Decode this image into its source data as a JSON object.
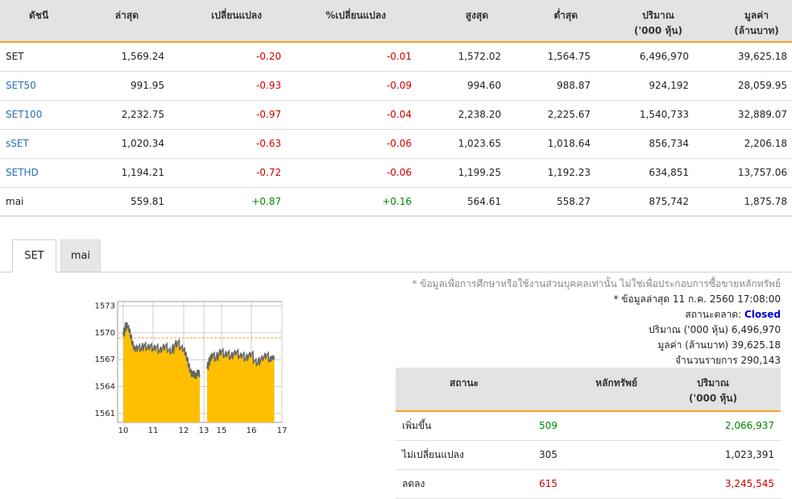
{
  "index_table": {
    "headers": {
      "name": "ดัชนี",
      "last": "ล่าสุด",
      "change": "เปลี่ยนแปลง",
      "pct_change": "%เปลี่ยนแปลง",
      "high": "สูงสุด",
      "low": "ต่ำสุด",
      "volume_l1": "ปริมาณ",
      "volume_l2": "('000 หุ้น)",
      "value_l1": "มูลค่า",
      "value_l2": "(ล้านบาท)"
    },
    "rows": [
      {
        "name": "SET",
        "last": "1,569.24",
        "change": "-0.20",
        "pct": "-0.01",
        "high": "1,572.02",
        "low": "1,564.75",
        "volume": "6,496,970",
        "value": "39,625.18"
      },
      {
        "name": "SET50",
        "last": "991.95",
        "change": "-0.93",
        "pct": "-0.09",
        "high": "994.60",
        "low": "988.87",
        "volume": "924,192",
        "value": "28,059.95"
      },
      {
        "name": "SET100",
        "last": "2,232.75",
        "change": "-0.97",
        "pct": "-0.04",
        "high": "2,238.20",
        "low": "2,225.67",
        "volume": "1,540,733",
        "value": "32,889.07"
      },
      {
        "name": "sSET",
        "last": "1,020.34",
        "change": "-0.63",
        "pct": "-0.06",
        "high": "1,023.65",
        "low": "1,018.64",
        "volume": "856,734",
        "value": "2,206.18"
      },
      {
        "name": "SETHD",
        "last": "1,194.21",
        "change": "-0.72",
        "pct": "-0.06",
        "high": "1,199.25",
        "low": "1,192.23",
        "volume": "634,851",
        "value": "13,757.06"
      },
      {
        "name": "mai",
        "last": "559.81",
        "change": "+0.87",
        "pct": "+0.16",
        "high": "564.61",
        "low": "558.27",
        "volume": "875,742",
        "value": "1,875.78"
      }
    ]
  },
  "tabs": [
    {
      "label": "SET"
    },
    {
      "label": "mai"
    }
  ],
  "chart_data": {
    "type": "area",
    "x_ticks": [
      "10",
      "11",
      "12",
      "13",
      "15",
      "16",
      "17"
    ],
    "y_ticks": [
      "1573",
      "1570",
      "1567",
      "1564",
      "1561"
    ],
    "ylim": [
      1560,
      1573.5
    ],
    "prev_close": 1569.44,
    "colors": {
      "fill": "#ffbf00",
      "line": "#666666",
      "prev_close": "#f4a326",
      "grid": "#cccccc"
    },
    "morning": {
      "x_range": [
        10.0,
        12.5
      ],
      "points": [
        [
          10.0,
          1569.7
        ],
        [
          10.05,
          1570.3
        ],
        [
          10.1,
          1570.9
        ],
        [
          10.15,
          1570.6
        ],
        [
          10.2,
          1570.2
        ],
        [
          10.25,
          1569.5
        ],
        [
          10.3,
          1568.8
        ],
        [
          10.35,
          1568.3
        ],
        [
          10.4,
          1568.0
        ],
        [
          10.5,
          1568.4
        ],
        [
          10.6,
          1568.1
        ],
        [
          10.7,
          1568.6
        ],
        [
          10.8,
          1568.2
        ],
        [
          10.9,
          1568.5
        ],
        [
          11.0,
          1568.1
        ],
        [
          11.1,
          1568.4
        ],
        [
          11.2,
          1567.9
        ],
        [
          11.3,
          1568.2
        ],
        [
          11.4,
          1568.5
        ],
        [
          11.5,
          1568.0
        ],
        [
          11.6,
          1567.8
        ],
        [
          11.7,
          1568.5
        ],
        [
          11.8,
          1568.9
        ],
        [
          11.9,
          1568.3
        ],
        [
          12.0,
          1568.1
        ],
        [
          12.05,
          1567.6
        ],
        [
          12.1,
          1567.0
        ],
        [
          12.15,
          1566.3
        ],
        [
          12.2,
          1565.7
        ],
        [
          12.25,
          1565.2
        ],
        [
          12.3,
          1565.5
        ],
        [
          12.35,
          1565.0
        ],
        [
          12.4,
          1565.3
        ],
        [
          12.45,
          1565.6
        ],
        [
          12.5,
          1565.2
        ]
      ]
    },
    "afternoon": {
      "x_range": [
        14.5,
        16.75
      ],
      "points": [
        [
          14.5,
          1566.0
        ],
        [
          14.55,
          1566.5
        ],
        [
          14.6,
          1567.0
        ],
        [
          14.65,
          1567.3
        ],
        [
          14.7,
          1567.5
        ],
        [
          14.8,
          1567.0
        ],
        [
          14.9,
          1567.6
        ],
        [
          15.0,
          1567.9
        ],
        [
          15.1,
          1567.4
        ],
        [
          15.2,
          1567.7
        ],
        [
          15.3,
          1567.2
        ],
        [
          15.4,
          1567.6
        ],
        [
          15.5,
          1567.8
        ],
        [
          15.6,
          1567.3
        ],
        [
          15.7,
          1567.5
        ],
        [
          15.8,
          1567.0
        ],
        [
          15.9,
          1567.4
        ],
        [
          16.0,
          1567.6
        ],
        [
          16.1,
          1566.8
        ],
        [
          16.2,
          1566.5
        ],
        [
          16.3,
          1567.0
        ],
        [
          16.4,
          1567.2
        ],
        [
          16.5,
          1567.5
        ],
        [
          16.6,
          1566.9
        ],
        [
          16.65,
          1567.1
        ],
        [
          16.7,
          1567.2
        ],
        [
          16.75,
          1567.2
        ]
      ]
    }
  },
  "info": {
    "disclaimer": "* ข้อมูลเพื่อการศึกษาหรือใช้งานส่วนบุคคลเท่านั้น ไม่ใช่เพื่อประกอบการซื้อขายหลักทรัพย์",
    "updated": "* ข้อมูลล่าสุด 11 ก.ค. 2560 17:08:00",
    "market_status_label": "สถานะตลาด:",
    "market_status_value": "Closed",
    "volume_label": "ปริมาณ ('000 หุ้น)",
    "volume_value": "6,496,970",
    "value_label": "มูลค่า (ล้านบาท)",
    "value_value": "39,625.18",
    "trans_label": "จำนวนรายการ",
    "trans_value": "290,143"
  },
  "status_table": {
    "headers": {
      "status": "สถานะ",
      "securities": "หลักทรัพย์",
      "volume_l1": "ปริมาณ",
      "volume_l2": "('000 หุ้น)"
    },
    "rows": [
      {
        "status": "เพิ่มขึ้น",
        "securities": "509",
        "volume": "2,066,937"
      },
      {
        "status": "ไม่เปลี่ยนแปลง",
        "securities": "305",
        "volume": "1,023,391"
      },
      {
        "status": "ลดลง",
        "securities": "615",
        "volume": "3,245,545"
      }
    ]
  }
}
